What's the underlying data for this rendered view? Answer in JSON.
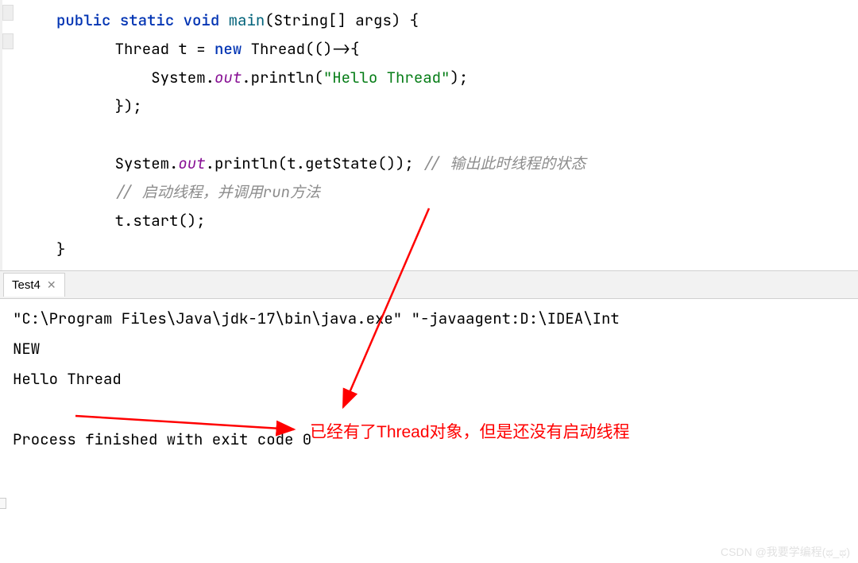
{
  "code": {
    "l1": {
      "kw1": "public",
      "kw2": "static",
      "kw3": "void",
      "method": "main",
      "params": "(String[] args) {"
    },
    "l2": {
      "pre": "    Thread t = ",
      "kw": "new",
      "post": " Thread(()->{"
    },
    "l3": {
      "pre": "        System.",
      "field": "out",
      "mid": ".println(",
      "str": "\"Hello Thread\"",
      "end": ");"
    },
    "l4": "    });",
    "l5": "",
    "l6": {
      "pre": "    System.",
      "field": "out",
      "mid": ".println(t.getState()); ",
      "comment": "// 输出此时线程的状态"
    },
    "l7_comment": "    // 启动线程，并调用run方法",
    "l8": "    t.start();",
    "l9": "}"
  },
  "tab": {
    "name": "Test4"
  },
  "console": {
    "l1": "\"C:\\Program Files\\Java\\jdk-17\\bin\\java.exe\" \"-javaagent:D:\\IDEA\\Int",
    "l2": "NEW",
    "l3": "Hello Thread",
    "l4": "",
    "l5": "Process finished with exit code 0"
  },
  "annotation": {
    "text": "已经有了Thread对象，但是还没有启动线程"
  },
  "watermark": "CSDN @我要学编程(ಥ_ಥ)"
}
